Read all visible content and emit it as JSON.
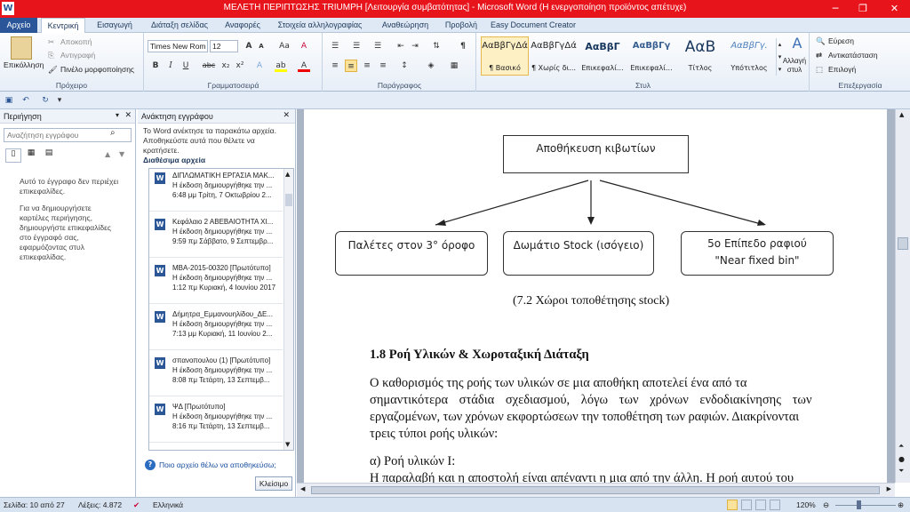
{
  "title_bar": {
    "app_icon": "W",
    "title": "ΜΕΛΕΤΗ ΠΕΡΙΠΤΩΣΗΣ TRIUMPH [Λειτουργία συμβατότητας] - Microsoft Word (Η ενεργοποίηση προϊόντος απέτυχε)",
    "minimize": "─",
    "restore": "❐",
    "close": "✕"
  },
  "tabs": [
    "Αρχείο",
    "Κεντρική",
    "Εισαγωγή",
    "Διάταξη σελίδας",
    "Αναφορές",
    "Στοιχεία αλληλογραφίας",
    "Αναθεώρηση",
    "Προβολή",
    "Easy Document Creator"
  ],
  "ribbon": {
    "clipboard": {
      "label": "Πρόχειρο",
      "paste": "Επικόλληση",
      "cut": "Αποκοπή",
      "copy": "Αντιγραφή",
      "format_painter": "Πινέλο μορφοποίησης"
    },
    "font": {
      "label": "Γραμματοσειρά",
      "family": "Times New Rom",
      "size": "12",
      "grow": "A",
      "shrink": "A",
      "change_case": "Aa",
      "clear": "A",
      "bold": "B",
      "italic": "I",
      "underline": "U",
      "strike": "abc",
      "sub": "x₂",
      "sup": "x²",
      "effects": "A",
      "highlight": "ab",
      "color": "A"
    },
    "paragraph": {
      "label": "Παράγραφος",
      "pilcrow": "¶"
    },
    "styles": {
      "label": "Στυλ",
      "items": [
        {
          "preview": "ΑαΒβΓγΔά",
          "name": "¶ Βασικό"
        },
        {
          "preview": "ΑαΒβΓγΔά",
          "name": "¶ Χωρίς δι..."
        },
        {
          "preview": "ΑαΒβΓ",
          "name": "Επικεφαλί..."
        },
        {
          "preview": "ΑαΒβΓγ",
          "name": "Επικεφαλί..."
        },
        {
          "preview": "ΑαΒ",
          "name": "Τίτλος"
        },
        {
          "preview": "ΑαΒβΓγ.",
          "name": "Υπότιτλος"
        }
      ],
      "change": "Αλλαγή στυλ"
    },
    "editing": {
      "label": "Επεξεργασία",
      "find": "Εύρεση",
      "replace": "Αντικατάσταση",
      "select": "Επιλογή"
    }
  },
  "nav_pane": {
    "title": "Περιήγηση",
    "search_placeholder": "Αναζήτηση εγγράφου",
    "msg1": "Αυτό το έγγραφο δεν περιέχει επικεφαλίδες.",
    "msg2": "Για να δημιουργήσετε καρτέλες περιήγησης, δημιουργήστε επικεφαλίδες στο έγγραφό σας, εφαρμόζοντας στυλ επικεφαλίδας."
  },
  "recovery_pane": {
    "title": "Ανάκτηση εγγράφου",
    "intro": "Το Word ανέκτησε τα παρακάτω αρχεία. Αποθηκεύστε αυτά που θέλετε να κρατήσετε.",
    "available": "Διαθέσιμα αρχεία",
    "files": [
      {
        "name": "ΔΙΠΛΩΜΑΤΙΚΗ ΕΡΓΑΣΙΑ ΜΑΚ...",
        "desc": "Η έκδοση δημιουργήθηκε την ...",
        "time": "6:48 μμ Τρίτη, 7 Οκτωβρίου 2..."
      },
      {
        "name": "Κεφάλαιο 2 ΑΒΕΒΑΙΟΤΗΤΑ ΧΙ...",
        "desc": "Η έκδοση δημιουργήθηκε την ...",
        "time": "9:59 πμ Σάββατο, 9 Σεπτεμβρ..."
      },
      {
        "name": "MBA-2015-00320 [Πρωτότυπο]",
        "desc": "Η έκδοση δημιουργήθηκε την ...",
        "time": "1:12 πμ Κυριακή, 4 Ιουνίου 2017"
      },
      {
        "name": "Δήμητρα_Εμμανουηλίδου_ΔΕ...",
        "desc": "Η έκδοση δημιουργήθηκε την ...",
        "time": "7:13 μμ Κυριακή, 11 Ιουνίου 2..."
      },
      {
        "name": "σπανοπουλου (1) [Πρωτότυπο]",
        "desc": "Η έκδοση δημιουργήθηκε την ...",
        "time": "8:08 πμ Τετάρτη, 13 Σεπτεμβ..."
      },
      {
        "name": "ΨΔ [Πρωτότυπο]",
        "desc": "Η έκδοση δημιουργήθηκε την ...",
        "time": "8:16 πμ Τετάρτη, 13 Σεπτεμβ..."
      }
    ],
    "help": "Ποιο αρχείο θέλω να αποθηκεύσω;",
    "close": "Κλείσιμο"
  },
  "document": {
    "diagram": {
      "top": "Αποθήκευση κιβωτίων",
      "left": "Παλέτες στον 3° όροφο",
      "middle": "Δωμάτιο Stock (ισόγειο)",
      "right1": "5ο Επίπεδο ραφιού",
      "right2": "\"Near fixed bin\""
    },
    "caption": "(7.2 Χώροι τοποθέτησης stock)",
    "heading": "1.8 Ροή Υλικών & Χωροταξική Διάταξη",
    "para_lines": [
      "Ο καθορισμός της ροής των υλικών σε μια αποθήκη αποτελεί ένα από τα",
      "σημαντικότερα στάδια σχεδιασμού, λόγω των χρόνων ενδοδιακίνησης των",
      "εργαζομένων, των χρόνων εκφορτώσεων την τοποθέτηση των ραφιών. Διακρίνονται",
      "τρεις τύποι ροής υλικών:"
    ],
    "sub": "α) Ροή υλικών Ι:",
    "last": "Η παραλαβή και η αποστολή είναι απέναντι η μια από την άλλη. Η ροή αυτού του"
  },
  "status": {
    "page": "Σελίδα: 10 από 27",
    "words": "Λέξεις: 4.872",
    "lang": "Ελληνικά",
    "zoom": "120%"
  }
}
